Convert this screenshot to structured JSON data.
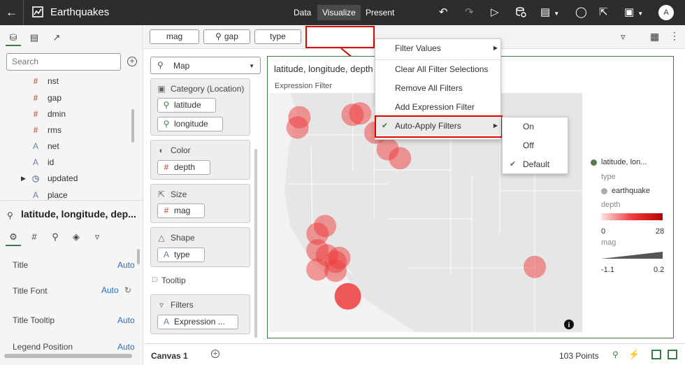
{
  "header": {
    "title": "Earthquakes",
    "tabs": [
      "Data",
      "Visualize",
      "Present"
    ],
    "active_tab": "Visualize",
    "avatar_initial": "A"
  },
  "left_panel": {
    "search_placeholder": "Search",
    "fields": [
      {
        "name": "nst",
        "kind": "number"
      },
      {
        "name": "gap",
        "kind": "number"
      },
      {
        "name": "dmin",
        "kind": "number"
      },
      {
        "name": "rms",
        "kind": "number"
      },
      {
        "name": "net",
        "kind": "text"
      },
      {
        "name": "id",
        "kind": "text"
      },
      {
        "name": "updated",
        "kind": "date"
      },
      {
        "name": "place",
        "kind": "text"
      }
    ],
    "viz_name": "latitude, longitude, dep...",
    "properties": [
      {
        "label": "Title",
        "value": "Auto"
      },
      {
        "label": "Title Font",
        "value": "Auto"
      },
      {
        "label": "Title Tooltip",
        "value": "Auto"
      },
      {
        "label": "Legend Position",
        "value": "Auto"
      }
    ]
  },
  "filter_bar": {
    "pills": [
      "mag",
      "gap",
      "type",
      ""
    ]
  },
  "grammar": {
    "viz_type": "Map",
    "sections": [
      {
        "label": "Category (Location)",
        "items": [
          "latitude",
          "longitude"
        ]
      },
      {
        "label": "Color",
        "items": [
          "depth"
        ]
      },
      {
        "label": "Size",
        "items": [
          "mag"
        ]
      },
      {
        "label": "Shape",
        "items": [
          "type"
        ]
      },
      {
        "label": "Tooltip",
        "items": []
      },
      {
        "label": "Filters",
        "items": [
          "Expression ..."
        ]
      }
    ]
  },
  "viz": {
    "title": "latitude, longitude, depth",
    "expression_filter": "Expression Filter",
    "bubbles": [
      {
        "lat": 47.6,
        "lon": -122.3
      },
      {
        "lat": 46.8,
        "lon": -122.5
      },
      {
        "lat": 47.8,
        "lon": -116.7
      },
      {
        "lat": 47.9,
        "lon": -115.9
      },
      {
        "lat": 46.4,
        "lon": -114.3
      },
      {
        "lat": 45.1,
        "lon": -113.0
      },
      {
        "lat": 44.4,
        "lon": -111.7
      },
      {
        "lat": 39.1,
        "lon": -119.6
      },
      {
        "lat": 38.5,
        "lon": -120.4
      },
      {
        "lat": 37.2,
        "lon": -120.4
      },
      {
        "lat": 36.8,
        "lon": -119.4
      },
      {
        "lat": 36.3,
        "lon": -118.5
      },
      {
        "lat": 36.6,
        "lon": -118.1
      },
      {
        "lat": 35.7,
        "lon": -120.4
      },
      {
        "lat": 35.6,
        "lon": -118.5
      },
      {
        "lat": 33.6,
        "lon": -117.2
      },
      {
        "lat": 35.9,
        "lon": -97.5
      }
    ],
    "legend": {
      "series": "latitude, lon...",
      "type_title": "type",
      "type_item": "earthquake",
      "depth_title": "depth",
      "depth_min": "0",
      "depth_max": "28",
      "mag_title": "mag",
      "mag_min": "-1.1",
      "mag_max": "0.2"
    }
  },
  "context_menu": {
    "items": [
      "Filter Values",
      "Clear All Filter Selections",
      "Remove All Filters",
      "Add Expression Filter",
      "Auto-Apply Filters"
    ],
    "submenu": [
      "On",
      "Off",
      "Default"
    ],
    "checked_item": "Auto-Apply Filters",
    "checked_sub": "Default"
  },
  "status": {
    "canvas_tab": "Canvas 1",
    "points": "103 Points"
  },
  "colors": {
    "accent": "#3a7d44",
    "highlight": "#e00000",
    "bubble": "#f03c3c"
  }
}
